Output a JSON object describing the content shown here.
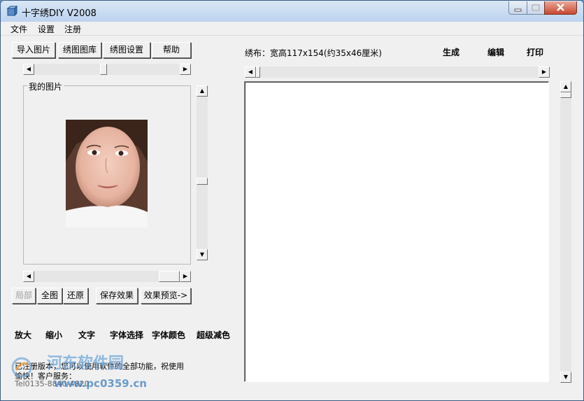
{
  "window": {
    "title": "十字绣DIY V2008",
    "controls": {
      "minimize": "minimize",
      "maximize": "maximize",
      "close": "close"
    }
  },
  "menu": [
    "文件",
    "设置",
    "注册"
  ],
  "toolbar": [
    "导入图片",
    "绣图图库",
    "绣图设置",
    "帮助"
  ],
  "left_panel": {
    "group_label": "我的图片"
  },
  "view_buttons": {
    "local": "局部",
    "full": "全图",
    "restore": "还原",
    "save_effect": "保存效果",
    "preview": "效果预览->"
  },
  "tools": [
    "放大",
    "缩小",
    "文字",
    "字体选择",
    "字体颜色",
    "超级减色"
  ],
  "right_panel": {
    "fabric_info": "绣布：宽高117x154(约35x46厘米)",
    "actions": [
      "生成",
      "编辑",
      "打印"
    ]
  },
  "footer": {
    "line1": "已注册版本，您可以使用软件的全部功能，祝使用",
    "line2": "愉快！客户服务：",
    "line3": "Tel0135-8840-4820"
  },
  "watermark": {
    "brand": "河东软件园",
    "url": "www.pc0359.cn"
  },
  "colors": {
    "titlebar": "#bcd3ee",
    "close_button": "#c8472f",
    "canvas": "#ffffff",
    "watermark": "#6fa6d8"
  }
}
